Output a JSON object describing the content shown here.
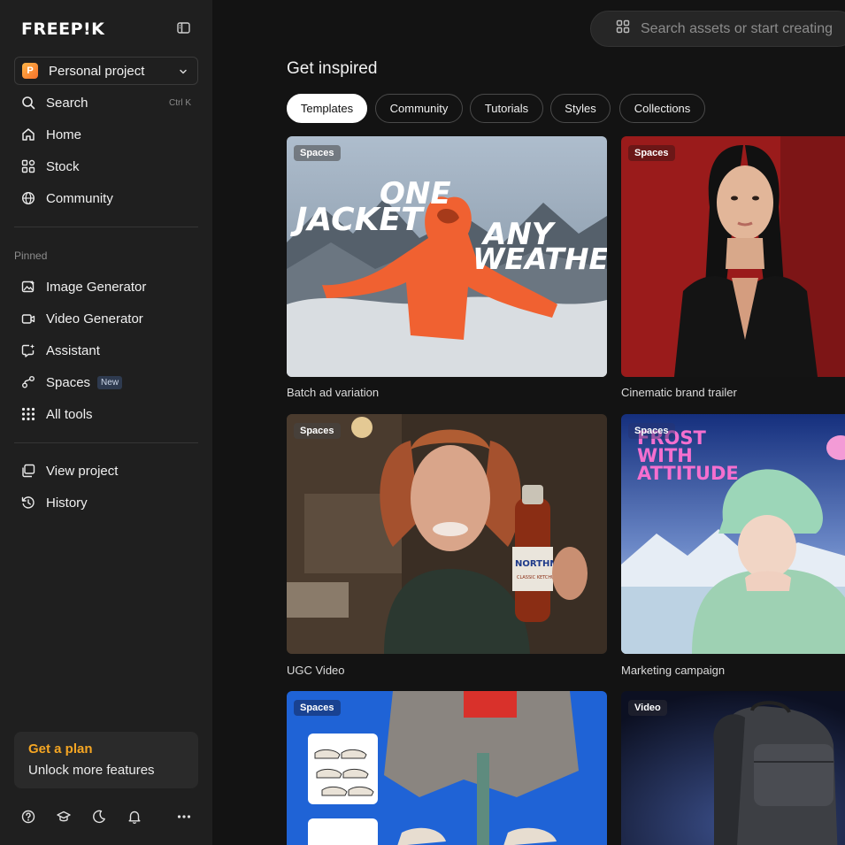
{
  "brand": {
    "logo_text": "FREEP!K"
  },
  "project": {
    "avatar_letter": "P",
    "name": "Personal project"
  },
  "nav_main": [
    {
      "label": "Search",
      "shortcut": "Ctrl K",
      "icon": "search-icon"
    },
    {
      "label": "Home",
      "icon": "home-icon"
    },
    {
      "label": "Stock",
      "icon": "stock-icon"
    },
    {
      "label": "Community",
      "icon": "globe-icon"
    }
  ],
  "pinned": {
    "section_label": "Pinned",
    "items": [
      {
        "label": "Image Generator",
        "icon": "image-generator-icon"
      },
      {
        "label": "Video Generator",
        "icon": "video-generator-icon"
      },
      {
        "label": "Assistant",
        "icon": "assistant-icon"
      },
      {
        "label": "Spaces",
        "badge": "New",
        "icon": "spaces-icon"
      },
      {
        "label": "All tools",
        "icon": "grid-icon"
      }
    ]
  },
  "nav_secondary": [
    {
      "label": "View project",
      "icon": "view-project-icon"
    },
    {
      "label": "History",
      "icon": "history-icon"
    }
  ],
  "plan": {
    "title": "Get a plan",
    "subtitle": "Unlock more features"
  },
  "bottom_icons": [
    "help-icon",
    "learn-icon",
    "theme-icon",
    "notifications-icon",
    "more-icon"
  ],
  "search": {
    "placeholder": "Search assets or start creating"
  },
  "page_title": "Get inspired",
  "tabs": [
    "Templates",
    "Community",
    "Tutorials",
    "Styles",
    "Collections"
  ],
  "active_tab": "Templates",
  "cards": [
    {
      "tag": "Spaces",
      "title": "Batch ad variation",
      "overlay_text": [
        "ONE",
        "JACKET",
        "ANY",
        "WEATHER"
      ]
    },
    {
      "tag": "Spaces",
      "title": "Cinematic brand trailer"
    },
    {
      "tag": "Spaces",
      "title": "UGC Video",
      "overlay_text": [
        "NORTHMIST",
        "CLASSIC KETCHUP"
      ]
    },
    {
      "tag": "Spaces",
      "title": "Marketing campaign",
      "overlay_text": [
        "FROST",
        "WITH",
        "ATTITUDE"
      ]
    },
    {
      "tag": "Spaces",
      "title": ""
    },
    {
      "tag": "Video",
      "title": ""
    }
  ],
  "colors": {
    "plan_accent": "#f5a623",
    "sidebar_bg": "#1f1f1f",
    "main_bg": "#131313"
  }
}
